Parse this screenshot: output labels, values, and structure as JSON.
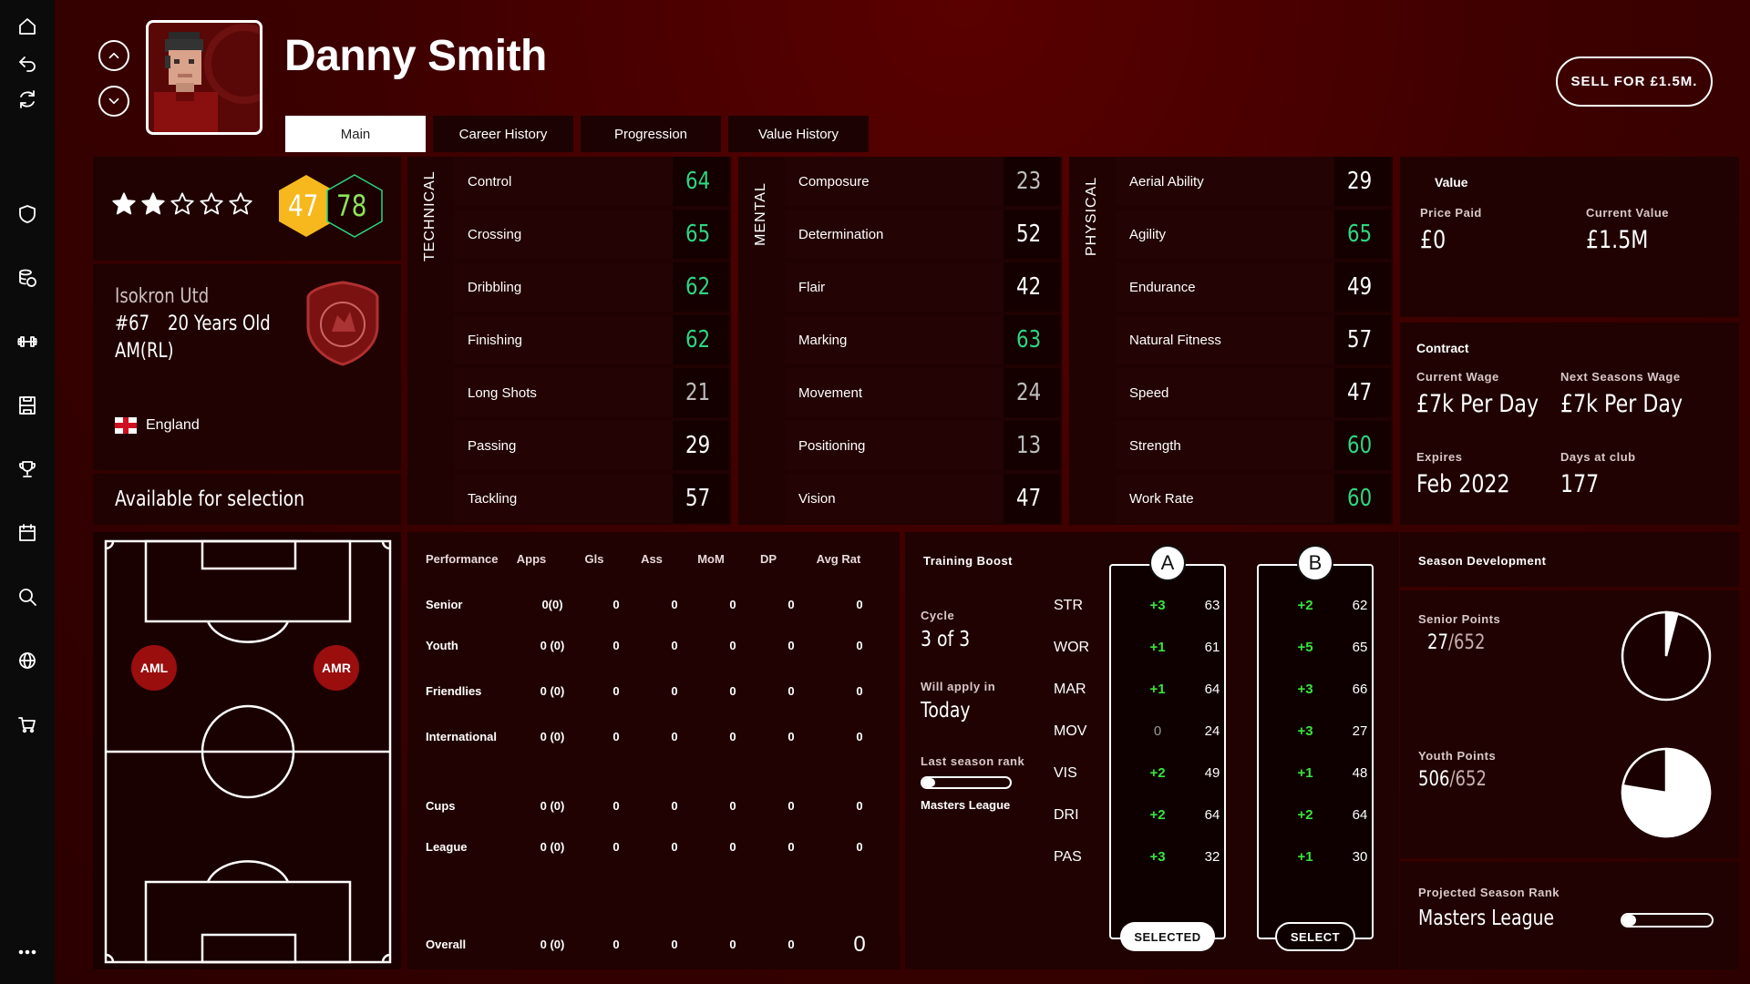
{
  "sidebar": {
    "icons": [
      "home-icon",
      "back-icon",
      "refresh-icon",
      "shield-icon",
      "finance-icon",
      "training-icon",
      "tactics-icon",
      "trophy-icon",
      "calendar-icon",
      "search-icon",
      "globe-icon",
      "cart-icon",
      "more-icon"
    ]
  },
  "header": {
    "player_name": "Danny Smith",
    "tabs": [
      {
        "label": "Main",
        "active": true
      },
      {
        "label": "Career History",
        "active": false
      },
      {
        "label": "Progression",
        "active": false
      },
      {
        "label": "Value History",
        "active": false
      }
    ],
    "sell_label": "SELL FOR £1.5M."
  },
  "card": {
    "stars_filled": 2,
    "stars_total": 5,
    "current_rating": "47",
    "potential_rating": "78",
    "club": "Isokron Utd",
    "number": "#67",
    "age": "20 Years Old",
    "position": "AM(RL)",
    "nationality": "England",
    "availability": "Available for selection"
  },
  "attributes": {
    "technical": {
      "label": "TECHNICAL",
      "items": [
        {
          "name": "Control",
          "value": "64",
          "color": "#2fd57f"
        },
        {
          "name": "Crossing",
          "value": "65",
          "color": "#2fd57f"
        },
        {
          "name": "Dribbling",
          "value": "62",
          "color": "#2fd57f"
        },
        {
          "name": "Finishing",
          "value": "62",
          "color": "#2fd57f"
        },
        {
          "name": "Long Shots",
          "value": "21",
          "color": "#bdbdbd"
        },
        {
          "name": "Passing",
          "value": "29",
          "color": "#ffffff"
        },
        {
          "name": "Tackling",
          "value": "57",
          "color": "#ffffff"
        }
      ]
    },
    "mental": {
      "label": "MENTAL",
      "items": [
        {
          "name": "Composure",
          "value": "23",
          "color": "#bdbdbd"
        },
        {
          "name": "Determination",
          "value": "52",
          "color": "#ffffff"
        },
        {
          "name": "Flair",
          "value": "42",
          "color": "#ffffff"
        },
        {
          "name": "Marking",
          "value": "63",
          "color": "#2fd57f"
        },
        {
          "name": "Movement",
          "value": "24",
          "color": "#bdbdbd"
        },
        {
          "name": "Positioning",
          "value": "13",
          "color": "#bdbdbd"
        },
        {
          "name": "Vision",
          "value": "47",
          "color": "#ffffff"
        }
      ]
    },
    "physical": {
      "label": "PHYSICAL",
      "items": [
        {
          "name": "Aerial Ability",
          "value": "29",
          "color": "#ffffff"
        },
        {
          "name": "Agility",
          "value": "65",
          "color": "#2fd57f"
        },
        {
          "name": "Endurance",
          "value": "49",
          "color": "#ffffff"
        },
        {
          "name": "Natural Fitness",
          "value": "57",
          "color": "#ffffff"
        },
        {
          "name": "Speed",
          "value": "47",
          "color": "#ffffff"
        },
        {
          "name": "Strength",
          "value": "60",
          "color": "#2fd57f"
        },
        {
          "name": "Work Rate",
          "value": "60",
          "color": "#2fd57f"
        }
      ]
    }
  },
  "value": {
    "title": "Value",
    "price_paid_label": "Price Paid",
    "price_paid": "£0",
    "current_value_label": "Current Value",
    "current_value": "£1.5M"
  },
  "contract": {
    "title": "Contract",
    "current_wage_label": "Current Wage",
    "current_wage": "£7k Per Day",
    "next_wage_label": "Next Seasons Wage",
    "next_wage": "£7k Per Day",
    "expires_label": "Expires",
    "expires": "Feb 2022",
    "days_label": "Days at club",
    "days": "177"
  },
  "pitch": {
    "positions": [
      "AML",
      "AMR"
    ]
  },
  "performance": {
    "headers": [
      "Performance",
      "Apps",
      "Gls",
      "Ass",
      "MoM",
      "DP",
      "Avg Rat"
    ],
    "rows": [
      {
        "label": "Senior",
        "cells": [
          "0(0)",
          "0",
          "0",
          "0",
          "0",
          "0"
        ]
      },
      {
        "label": "Youth",
        "cells": [
          "0 (0)",
          "0",
          "0",
          "0",
          "0",
          "0"
        ]
      },
      {
        "label": "Friendlies",
        "cells": [
          "0 (0)",
          "0",
          "0",
          "0",
          "0",
          "0"
        ]
      },
      {
        "label": "International",
        "cells": [
          "0 (0)",
          "0",
          "0",
          "0",
          "0",
          "0"
        ]
      },
      {
        "label": "Cups",
        "cells": [
          "0 (0)",
          "0",
          "0",
          "0",
          "0",
          "0"
        ]
      },
      {
        "label": "League",
        "cells": [
          "0 (0)",
          "0",
          "0",
          "0",
          "0",
          "0"
        ]
      },
      {
        "label": "Overall",
        "cells": [
          "0 (0)",
          "0",
          "0",
          "0",
          "0",
          "0"
        ]
      }
    ]
  },
  "training": {
    "title": "Training Boost",
    "cycle_label": "Cycle",
    "cycle": "3 of 3",
    "apply_label": "Will apply in",
    "apply": "Today",
    "rank_label": "Last season rank",
    "rank_progress": 0.15,
    "rank_league": "Masters League",
    "stats": [
      "STR",
      "WOR",
      "MAR",
      "MOV",
      "VIS",
      "DRI",
      "PAS"
    ],
    "option_a": {
      "label": "A",
      "boosts": [
        "+3",
        "+1",
        "+1",
        "0",
        "+2",
        "+2",
        "+3"
      ],
      "values": [
        "63",
        "61",
        "64",
        "24",
        "49",
        "64",
        "32"
      ],
      "button": "SELECTED"
    },
    "option_b": {
      "label": "B",
      "boosts": [
        "+2",
        "+5",
        "+3",
        "+3",
        "+1",
        "+2",
        "+1"
      ],
      "values": [
        "62",
        "65",
        "66",
        "27",
        "48",
        "64",
        "30"
      ],
      "button": "SELECT"
    }
  },
  "season_dev": {
    "title": "Season Development",
    "senior_label": "Senior Points",
    "senior_value": "27",
    "senior_max": "/652",
    "senior_fraction": 0.041,
    "youth_label": "Youth Points",
    "youth_value": "506",
    "youth_max": "/652",
    "youth_fraction": 0.776,
    "projected_label": "Projected Season Rank",
    "projected_league": "Masters League",
    "projected_progress": 0.15
  }
}
